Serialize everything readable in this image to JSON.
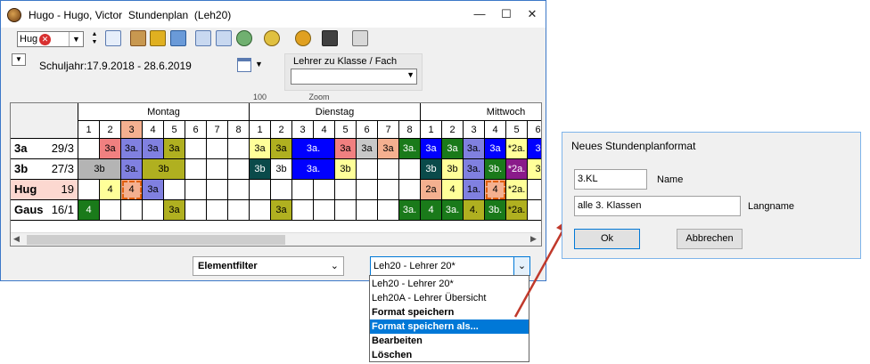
{
  "window": {
    "title": "Hugo - Hugo, Victor  Stundenplan  (Leh20)",
    "controls": {
      "minimize": "—",
      "maximize": "☐",
      "close": "✕"
    }
  },
  "toolbar": {
    "element_value": "Hug",
    "icons": [
      "grid-icon",
      "export-icon",
      "lock-icon",
      "undo-icon",
      "edit-icon",
      "pin-icon",
      "person-icon",
      "settings-icon",
      "gear-icon",
      "teacher-hat-icon",
      "print-icon"
    ]
  },
  "subbar": {
    "schuljahr": "Schuljahr:17.9.2018 - 28.6.2019",
    "lzk_label": "Lehrer zu Klasse / Fach",
    "lzk_value": "",
    "zoom_value": "100",
    "zoom_label": "Zoom"
  },
  "timetable": {
    "days": [
      "Montag",
      "Dienstag",
      "Mittwoch"
    ],
    "periods": [
      "1",
      "2",
      "3",
      "4",
      "5",
      "6",
      "7",
      "8"
    ],
    "rows": [
      {
        "name": "3a",
        "hours": "29/3"
      },
      {
        "name": "3b",
        "hours": "27/3"
      },
      {
        "name": "Hug",
        "hours": "19"
      },
      {
        "name": "Gaus",
        "hours": "16/1"
      }
    ],
    "lessons": [
      {
        "row": 0,
        "day": 0,
        "p": 1,
        "text": "3a",
        "bg": "#f08080"
      },
      {
        "row": 0,
        "day": 0,
        "p": 2,
        "text": "3a.",
        "bg": "#8080e0"
      },
      {
        "row": 0,
        "day": 0,
        "p": 3,
        "text": "3a",
        "bg": "#8080e0"
      },
      {
        "row": 0,
        "day": 0,
        "p": 4,
        "text": "3a",
        "bg": "#b0b020"
      },
      {
        "row": 0,
        "day": 1,
        "p": 0,
        "text": "3a",
        "bg": "#ffff99"
      },
      {
        "row": 0,
        "day": 1,
        "p": 1,
        "text": "3a",
        "bg": "#b0b020"
      },
      {
        "row": 0,
        "day": 1,
        "p": 2,
        "span": 2,
        "text": "3a.",
        "bg": "#0000ff",
        "fg": "#ffffff"
      },
      {
        "row": 0,
        "day": 1,
        "p": 4,
        "text": "3a",
        "bg": "#f08080"
      },
      {
        "row": 0,
        "day": 1,
        "p": 5,
        "text": "3a",
        "bg": "#c8c8c8"
      },
      {
        "row": 0,
        "day": 1,
        "p": 6,
        "text": "3a",
        "bg": "#f4b090"
      },
      {
        "row": 0,
        "day": 1,
        "p": 7,
        "text": "3a.",
        "bg": "#1a7a1a",
        "fg": "#ffffff"
      },
      {
        "row": 0,
        "day": 2,
        "p": 0,
        "text": "3a",
        "bg": "#0000ff",
        "fg": "#ffffff"
      },
      {
        "row": 0,
        "day": 2,
        "p": 1,
        "text": "3a",
        "bg": "#1a7a1a",
        "fg": "#ffffff"
      },
      {
        "row": 0,
        "day": 2,
        "p": 2,
        "text": "3a.",
        "bg": "#8080e0"
      },
      {
        "row": 0,
        "day": 2,
        "p": 3,
        "text": "3a",
        "bg": "#0000ff",
        "fg": "#ffffff"
      },
      {
        "row": 0,
        "day": 2,
        "p": 4,
        "text": "*2a.",
        "bg": "#ffff99"
      },
      {
        "row": 0,
        "day": 2,
        "p": 5,
        "text": "3",
        "bg": "#0000ff",
        "fg": "#ffffff"
      },
      {
        "row": 1,
        "day": 0,
        "p": 0,
        "span": 2,
        "text": "3b",
        "bg": "#b4b4b4"
      },
      {
        "row": 1,
        "day": 0,
        "p": 2,
        "text": "3a.",
        "bg": "#8080e0"
      },
      {
        "row": 1,
        "day": 0,
        "p": 3,
        "span": 2,
        "text": "3b",
        "bg": "#b0b020"
      },
      {
        "row": 1,
        "day": 1,
        "p": 0,
        "text": "3b",
        "bg": "#0a4a4a",
        "fg": "#ffffff"
      },
      {
        "row": 1,
        "day": 1,
        "p": 1,
        "text": "3b",
        "bg": "#ffffff"
      },
      {
        "row": 1,
        "day": 1,
        "p": 2,
        "span": 2,
        "text": "3a.",
        "bg": "#0000ff",
        "fg": "#ffffff"
      },
      {
        "row": 1,
        "day": 1,
        "p": 4,
        "text": "3b",
        "bg": "#ffff99"
      },
      {
        "row": 1,
        "day": 2,
        "p": 0,
        "text": "3b",
        "bg": "#0a4a4a",
        "fg": "#ffffff"
      },
      {
        "row": 1,
        "day": 2,
        "p": 1,
        "text": "3b",
        "bg": "#ffff99"
      },
      {
        "row": 1,
        "day": 2,
        "p": 2,
        "text": "3a.",
        "bg": "#8080e0"
      },
      {
        "row": 1,
        "day": 2,
        "p": 3,
        "text": "3b.",
        "bg": "#1a7a1a",
        "fg": "#ffffff"
      },
      {
        "row": 1,
        "day": 2,
        "p": 4,
        "text": "*2a.",
        "bg": "#8a1a8a",
        "fg": "#ffffff"
      },
      {
        "row": 1,
        "day": 2,
        "p": 5,
        "text": "3",
        "bg": "#ffff99"
      },
      {
        "row": 2,
        "day": 0,
        "p": 1,
        "text": "4",
        "bg": "#ffff99"
      },
      {
        "row": 2,
        "day": 0,
        "p": 2,
        "text": "4",
        "bg": "#f4b090",
        "dashed": true
      },
      {
        "row": 2,
        "day": 0,
        "p": 3,
        "text": "3a",
        "bg": "#8080e0"
      },
      {
        "row": 2,
        "day": 2,
        "p": 0,
        "text": "2a",
        "bg": "#f4b090"
      },
      {
        "row": 2,
        "day": 2,
        "p": 1,
        "text": "4",
        "bg": "#ffff99"
      },
      {
        "row": 2,
        "day": 2,
        "p": 2,
        "text": "1a.",
        "bg": "#8080e0"
      },
      {
        "row": 2,
        "day": 2,
        "p": 3,
        "text": "4",
        "bg": "#f4b090",
        "dashed": true
      },
      {
        "row": 2,
        "day": 2,
        "p": 4,
        "text": "*2a.",
        "bg": "#ffff99"
      },
      {
        "row": 3,
        "day": 0,
        "p": 0,
        "text": "4",
        "bg": "#1a7a1a",
        "fg": "#ffffff"
      },
      {
        "row": 3,
        "day": 0,
        "p": 4,
        "text": "3a",
        "bg": "#b0b020"
      },
      {
        "row": 3,
        "day": 1,
        "p": 1,
        "text": "3a",
        "bg": "#b0b020"
      },
      {
        "row": 3,
        "day": 1,
        "p": 7,
        "text": "3a.",
        "bg": "#1a7a1a",
        "fg": "#ffffff"
      },
      {
        "row": 3,
        "day": 2,
        "p": 0,
        "text": "4",
        "bg": "#1a7a1a",
        "fg": "#ffffff"
      },
      {
        "row": 3,
        "day": 2,
        "p": 1,
        "text": "3a.",
        "bg": "#1a7a1a",
        "fg": "#ffffff"
      },
      {
        "row": 3,
        "day": 2,
        "p": 2,
        "text": "4.",
        "bg": "#b0b020"
      },
      {
        "row": 3,
        "day": 2,
        "p": 3,
        "text": "3b.",
        "bg": "#1a7a1a",
        "fg": "#ffffff"
      },
      {
        "row": 3,
        "day": 2,
        "p": 4,
        "text": "*2a.",
        "bg": "#b0b020"
      }
    ],
    "highlight_period_bg": "#f4b090"
  },
  "filter": {
    "value": "Elementfilter"
  },
  "format_combo": {
    "value": "Leh20 - Lehrer 20*"
  },
  "dropdown": {
    "items": [
      {
        "label": "Leh20 - Lehrer 20*",
        "bold": false,
        "selected": false
      },
      {
        "label": "Leh20A - Lehrer Übersicht",
        "bold": false,
        "selected": false
      },
      {
        "label": "Format speichern",
        "bold": true,
        "selected": false
      },
      {
        "label": "Format speichern als...",
        "bold": true,
        "selected": true
      },
      {
        "label": "Bearbeiten",
        "bold": true,
        "selected": false
      },
      {
        "label": "Löschen",
        "bold": true,
        "selected": false
      }
    ]
  },
  "dialog": {
    "title": "Neues Stundenplanformat",
    "name_value": "3.KL",
    "name_label": "Name",
    "langname_value": "alle 3. Klassen",
    "langname_label": "Langname",
    "ok_label": "Ok",
    "cancel_label": "Abbrechen"
  },
  "colors": {
    "accent": "#0078d7",
    "arrow": "#c0392b"
  }
}
